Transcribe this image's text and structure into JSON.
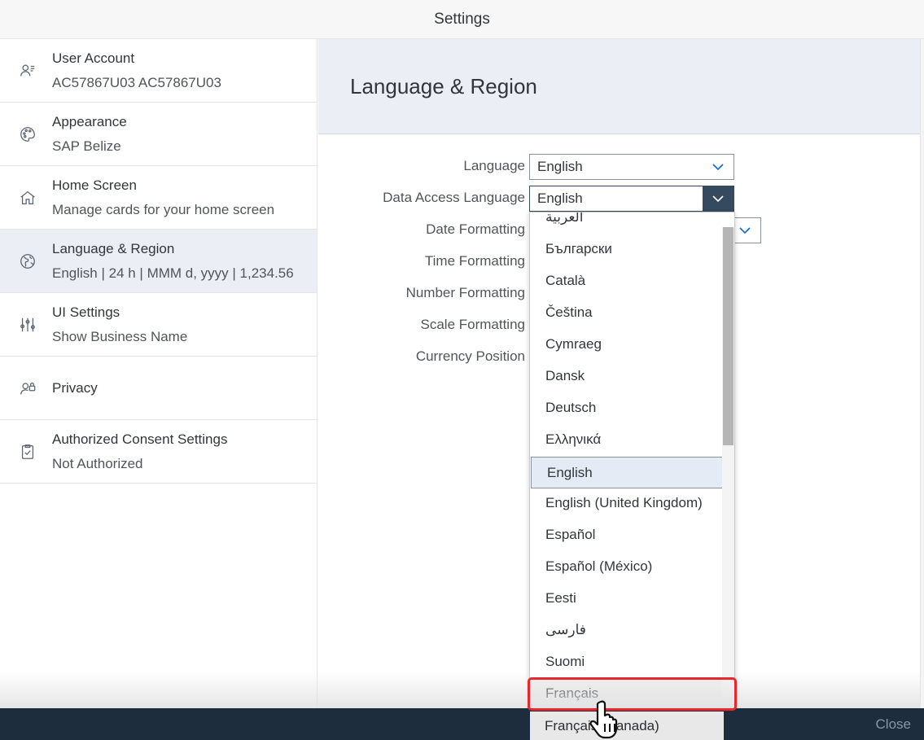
{
  "window": {
    "title": "Settings"
  },
  "sidebar": {
    "items": [
      {
        "label": "User Account",
        "sub": "AC57867U03 AC57867U03",
        "icon": "user-account-icon"
      },
      {
        "label": "Appearance",
        "sub": "SAP Belize",
        "icon": "palette-icon"
      },
      {
        "label": "Home Screen",
        "sub": "Manage cards for your home screen",
        "icon": "home-icon"
      },
      {
        "label": "Language & Region",
        "sub": "English | 24 h | MMM d, yyyy | 1,234.56",
        "icon": "globe-icon",
        "selected": true
      },
      {
        "label": "UI Settings",
        "sub": "Show Business Name",
        "icon": "sliders-icon"
      },
      {
        "label": "Privacy",
        "sub": "",
        "icon": "user-lock-icon"
      },
      {
        "label": "Authorized Consent Settings",
        "sub": "Not Authorized",
        "icon": "clipboard-check-icon"
      }
    ]
  },
  "main": {
    "title": "Language & Region",
    "fields": [
      {
        "label": "Language",
        "value": "English"
      },
      {
        "label": "Data Access Language",
        "value": "English"
      },
      {
        "label": "Date Formatting"
      },
      {
        "label": "Time Formatting"
      },
      {
        "label": "Number Formatting"
      },
      {
        "label": "Scale Formatting"
      },
      {
        "label": "Currency Position"
      }
    ]
  },
  "dropdown": {
    "items": [
      "العربية",
      "Български",
      "Català",
      "Čeština",
      "Cymraeg",
      "Dansk",
      "Deutsch",
      "Ελληνικά",
      "English",
      "English (United Kingdom)",
      "Español",
      "Español (México)",
      "Eesti",
      "فارسی",
      "Suomi",
      "Français"
    ],
    "selected": "English",
    "highlighted": "Français",
    "partial_item": "Français (Canada)"
  },
  "footer": {
    "close_label": "Close"
  },
  "colors": {
    "accent": "#0a6ed1",
    "selected_bg": "#ebeef5",
    "highlight": "#e8262b",
    "footer_bg": "#1d2d3e"
  }
}
